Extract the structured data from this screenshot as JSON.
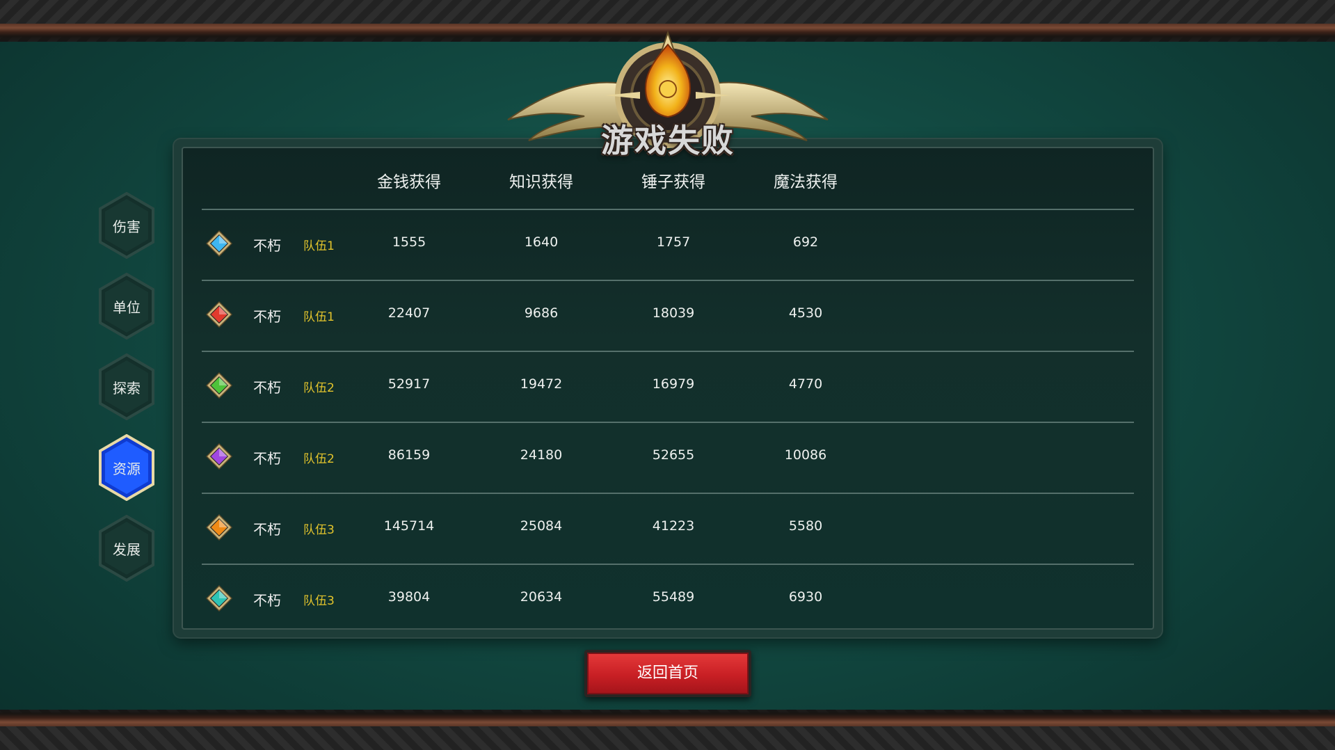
{
  "title": "游戏失败",
  "side_tabs": [
    {
      "label": "伤害",
      "active": false
    },
    {
      "label": "单位",
      "active": false
    },
    {
      "label": "探索",
      "active": false
    },
    {
      "label": "资源",
      "active": true
    },
    {
      "label": "发展",
      "active": false
    }
  ],
  "columns": [
    "金钱获得",
    "知识获得",
    "锤子获得",
    "魔法获得"
  ],
  "rows": [
    {
      "gem_color": "#3fb6f0",
      "player": "不朽",
      "team": "队伍1",
      "values": [
        "1555",
        "1640",
        "1757",
        "692"
      ]
    },
    {
      "gem_color": "#e23a2e",
      "player": "不朽",
      "team": "队伍1",
      "values": [
        "22407",
        "9686",
        "18039",
        "4530"
      ]
    },
    {
      "gem_color": "#4ec23a",
      "player": "不朽",
      "team": "队伍2",
      "values": [
        "52917",
        "19472",
        "16979",
        "4770"
      ]
    },
    {
      "gem_color": "#a047e0",
      "player": "不朽",
      "team": "队伍2",
      "values": [
        "86159",
        "24180",
        "52655",
        "10086"
      ]
    },
    {
      "gem_color": "#f08a16",
      "player": "不朽",
      "team": "队伍3",
      "values": [
        "145714",
        "25084",
        "41223",
        "5580"
      ]
    },
    {
      "gem_color": "#2ec3b4",
      "player": "不朽",
      "team": "队伍3",
      "values": [
        "39804",
        "20634",
        "55489",
        "6930"
      ]
    }
  ],
  "home_button": "返回首页",
  "colors": {
    "team": "#e3c42c",
    "active_tab": "#1f5cff",
    "button": "#c81f24"
  }
}
